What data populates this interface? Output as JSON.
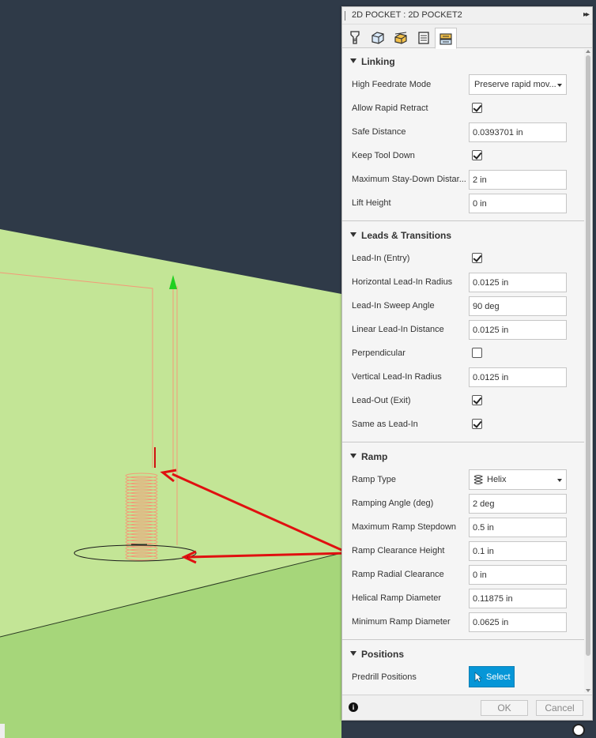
{
  "window": {
    "title": "2D POCKET : 2D POCKET2",
    "expand_glyph": "▸▸"
  },
  "tabs": [
    {
      "name": "tool-tab",
      "icon": "tool-icon"
    },
    {
      "name": "geometry-tab",
      "icon": "geometry-icon"
    },
    {
      "name": "heights-tab",
      "icon": "heights-icon"
    },
    {
      "name": "passes-tab",
      "icon": "passes-icon"
    },
    {
      "name": "linking-tab",
      "icon": "linking-icon",
      "active": true
    }
  ],
  "sections": {
    "linking": {
      "label": "Linking",
      "high_feedrate_mode": {
        "label": "High Feedrate Mode",
        "value": "Preserve rapid mov..."
      },
      "allow_rapid_retract": {
        "label": "Allow Rapid Retract",
        "checked": true
      },
      "safe_distance": {
        "label": "Safe Distance",
        "value": "0.0393701 in"
      },
      "keep_tool_down": {
        "label": "Keep Tool Down",
        "checked": true
      },
      "max_stay_down": {
        "label": "Maximum Stay-Down Distar...",
        "value": "2 in"
      },
      "lift_height": {
        "label": "Lift Height",
        "value": "0 in"
      }
    },
    "leads": {
      "label": "Leads & Transitions",
      "lead_in": {
        "label": "Lead-In (Entry)",
        "checked": true
      },
      "horizontal_lead_in_radius": {
        "label": "Horizontal Lead-In Radius",
        "value": "0.0125 in"
      },
      "lead_in_sweep_angle": {
        "label": "Lead-In Sweep Angle",
        "value": "90 deg"
      },
      "linear_lead_in_distance": {
        "label": "Linear Lead-In Distance",
        "value": "0.0125 in"
      },
      "perpendicular": {
        "label": "Perpendicular",
        "checked": false
      },
      "vertical_lead_in_radius": {
        "label": "Vertical Lead-In Radius",
        "value": "0.0125 in"
      },
      "lead_out": {
        "label": "Lead-Out (Exit)",
        "checked": true
      },
      "same_as_lead_in": {
        "label": "Same as Lead-In",
        "checked": true
      }
    },
    "ramp": {
      "label": "Ramp",
      "ramp_type": {
        "label": "Ramp Type",
        "value": "Helix",
        "icon": "helix-icon"
      },
      "ramping_angle": {
        "label": "Ramping Angle (deg)",
        "value": "2 deg"
      },
      "max_ramp_stepdown": {
        "label": "Maximum Ramp Stepdown",
        "value": "0.5 in"
      },
      "ramp_clearance_height": {
        "label": "Ramp Clearance Height",
        "value": "0.1 in"
      },
      "ramp_radial_clearance": {
        "label": "Ramp Radial Clearance",
        "value": "0 in"
      },
      "helical_ramp_diameter": {
        "label": "Helical Ramp Diameter",
        "value": "0.11875 in"
      },
      "min_ramp_diameter": {
        "label": "Minimum Ramp Diameter",
        "value": "0.0625 in"
      }
    },
    "positions": {
      "label": "Positions",
      "predrill_positions": {
        "label": "Predrill Positions",
        "button": "Select"
      }
    }
  },
  "footer": {
    "info_glyph": "i",
    "ok": "OK",
    "cancel": "Cancel"
  },
  "colors": {
    "viewport_bg": "#2f3a48",
    "stock_top": "#c3e596",
    "stock_side": "#a6d67a",
    "toolpath": "#f39a78",
    "annotation_arrow": "#e01010",
    "accent": "#0696d7"
  }
}
